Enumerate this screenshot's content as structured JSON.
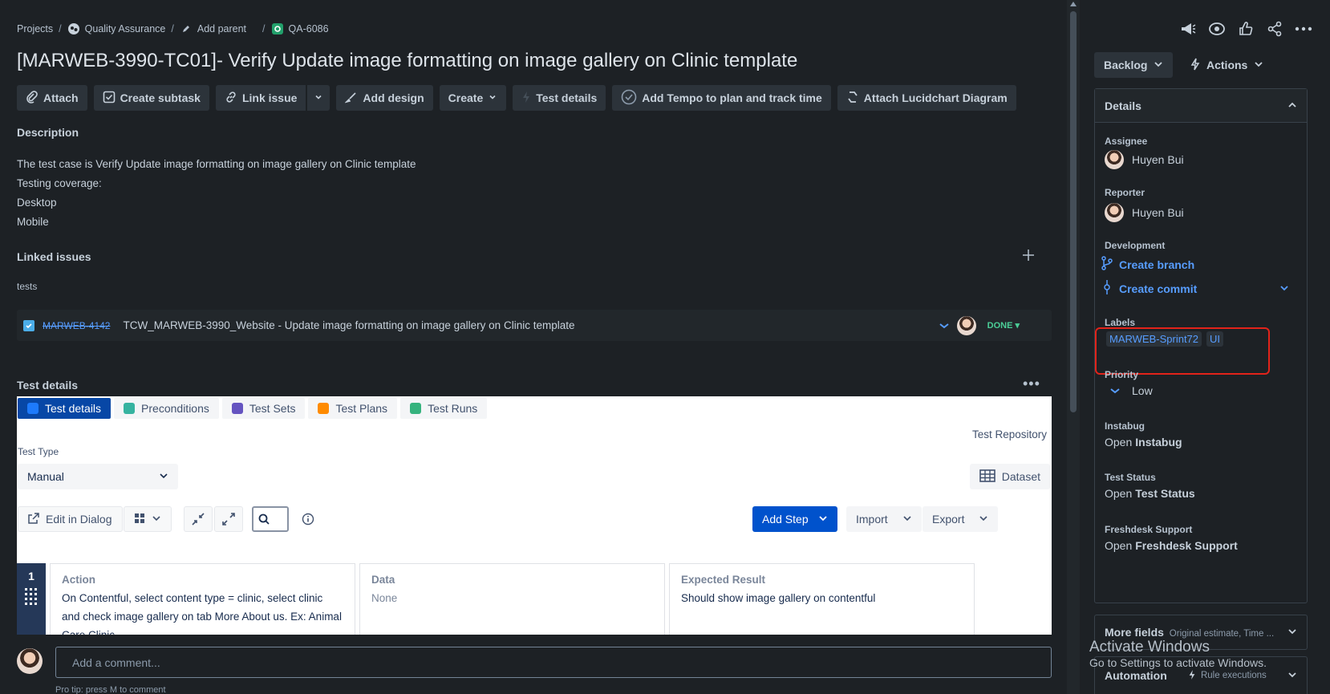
{
  "breadcrumb": {
    "projects": "Projects",
    "project": "Quality Assurance",
    "add_parent": "Add parent",
    "issue_key": "QA-6086"
  },
  "issue": {
    "title": "[MARWEB-3990-TC01]- Verify Update image formatting on image gallery on Clinic template"
  },
  "toolbar": {
    "attach": "Attach",
    "create_subtask": "Create subtask",
    "link_issue": "Link issue",
    "add_design": "Add design",
    "create": "Create",
    "test_details": "Test details",
    "add_tempo": "Add Tempo to plan and track time",
    "attach_lucid": "Attach Lucidchart Diagram"
  },
  "description": {
    "heading": "Description",
    "lines": [
      "The test case is Verify Update image formatting on image gallery on Clinic template",
      "Testing coverage:",
      "Desktop",
      "Mobile"
    ]
  },
  "linked": {
    "heading": "Linked issues",
    "relation": "tests",
    "key": "MARWEB-4142",
    "summary": "TCW_MARWEB-3990_Website - Update image formatting on image gallery on Clinic template",
    "status": "DONE"
  },
  "test_details": {
    "heading": "Test details",
    "tabs": [
      "Test details",
      "Preconditions",
      "Test Sets",
      "Test Plans",
      "Test Runs"
    ],
    "tab_colors": [
      "#1d7afc",
      "#36b37e",
      "#6554c0",
      "#ff8b00",
      "#36b37e"
    ],
    "repository": "Test Repository",
    "test_type_label": "Test Type",
    "test_type_value": "Manual",
    "dataset": "Dataset",
    "edit_in_dialog": "Edit in Dialog",
    "add_step": "Add Step",
    "import": "Import",
    "export": "Export",
    "step_number": "1",
    "col_action": "Action",
    "col_data": "Data",
    "col_expected": "Expected Result",
    "action_text": "On Contentful, select content type = clinic, select clinic and check image gallery on tab More About us. Ex: Animal Care Clinic",
    "data_text": "None",
    "expected_text": "Should show image gallery on contentful"
  },
  "comment": {
    "placeholder": "Add a comment...",
    "protip": "Pro tip: press M to comment"
  },
  "sidebar": {
    "status": "Backlog",
    "actions": "Actions",
    "details_heading": "Details",
    "assignee_label": "Assignee",
    "assignee": "Huyen Bui",
    "reporter_label": "Reporter",
    "reporter": "Huyen Bui",
    "development_label": "Development",
    "create_branch": "Create branch",
    "create_commit": "Create commit",
    "labels_label": "Labels",
    "labels": [
      "MARWEB-Sprint72",
      "UI"
    ],
    "priority_label": "Priority",
    "priority": "Low",
    "instabug_label": "Instabug",
    "instabug_open": "Open",
    "instabug_name": "Instabug",
    "test_status_label": "Test Status",
    "test_status_open": "Open",
    "test_status_name": "Test Status",
    "freshdesk_label": "Freshdesk Support",
    "freshdesk_open": "Open",
    "freshdesk_name": "Freshdesk Support",
    "more_fields": "More fields",
    "more_fields_hint": "Original estimate, Time ...",
    "automation": "Automation",
    "rule_executions": "Rule executions"
  },
  "watermark": {
    "line1": "Activate Windows",
    "line2": "Go to Settings to activate Windows."
  }
}
